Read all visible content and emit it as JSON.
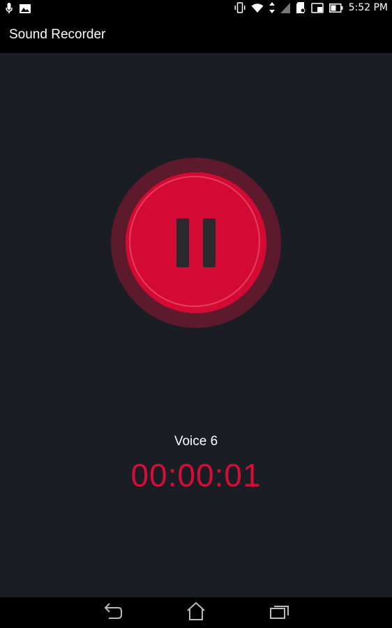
{
  "status_bar": {
    "time": "5:52 PM",
    "left_icons": [
      "microphone-icon",
      "image-icon"
    ],
    "right_icons": [
      "vibrate-icon",
      "wifi-icon",
      "data-transfer-icon",
      "signal-icon",
      "sd-card-icon",
      "cast-icon",
      "battery-icon"
    ]
  },
  "app_bar": {
    "title": "Sound Recorder"
  },
  "recorder": {
    "control_icon": "pause-icon",
    "recording_name": "Voice 6",
    "elapsed_time": "00:00:01",
    "accent_color": "#d30a34"
  },
  "nav_bar": {
    "icons": [
      "back-icon",
      "home-icon",
      "recents-icon"
    ]
  }
}
